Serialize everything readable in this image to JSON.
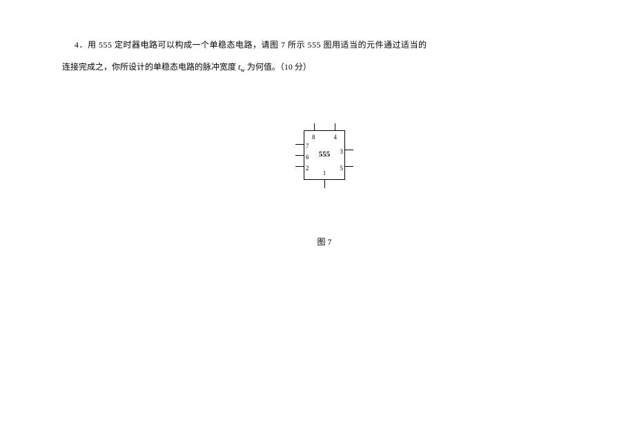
{
  "question": {
    "number": "4．",
    "text_part1": "用 555 定时器电路可以构成一个单稳态电路，请图 7 所示 555 图用适当的元件通过适当的",
    "text_part2_a": "连接完成之，你所设计的单稳态电路的脉冲宽度 ",
    "var": "t",
    "sub": "w",
    "text_part2_b": " 为何值。（10 分）"
  },
  "chip": {
    "label": "555",
    "pins": {
      "p1": "1",
      "p2": "2",
      "p3": "3",
      "p4": "4",
      "p5": "5",
      "p6": "6",
      "p7": "7",
      "p8": "8"
    }
  },
  "figure_caption": "图 7"
}
